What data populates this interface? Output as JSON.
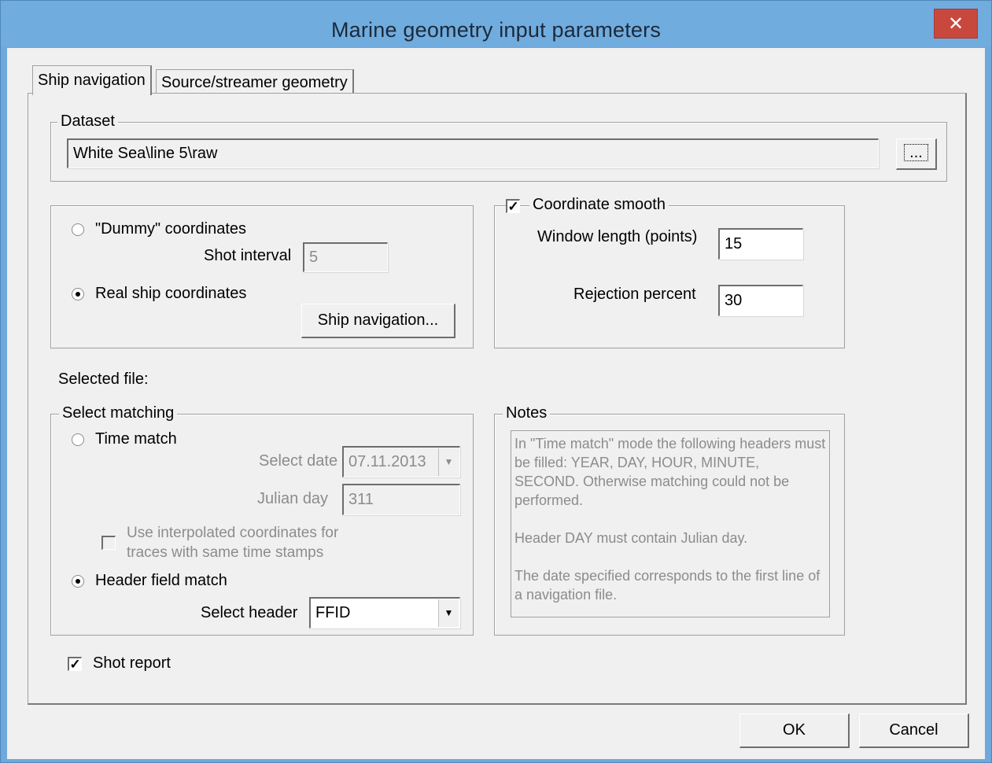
{
  "window": {
    "title": "Marine geometry input parameters",
    "close_glyph": "✕"
  },
  "tabs": [
    {
      "label": "Ship navigation",
      "active": true
    },
    {
      "label": "Source/streamer geometry",
      "active": false
    }
  ],
  "dataset": {
    "group_label": "Dataset",
    "path": "White Sea\\line 5\\raw",
    "browse_label": "..."
  },
  "coord_mode": {
    "dummy_label": "\"Dummy\" coordinates",
    "shot_interval_label": "Shot interval",
    "shot_interval_value": "5",
    "real_label": "Real  ship coordinates",
    "ship_nav_button": "Ship navigation...",
    "selected": "real"
  },
  "smooth": {
    "checkbox_label": "Coordinate smooth",
    "checked": true,
    "window_length_label": "Window length (points)",
    "window_length_value": "15",
    "rejection_label": "Rejection percent",
    "rejection_value": "30"
  },
  "selected_file_label": "Selected file:",
  "matching": {
    "group_label": "Select matching",
    "time_match_label": "Time match",
    "select_date_label": "Select date",
    "select_date_value": "07.11.2013",
    "julian_day_label": "Julian day",
    "julian_day_value": "311",
    "interp_label_line1": "Use interpolated coordinates for",
    "interp_label_line2": "traces with same time stamps",
    "header_match_label": "Header field match",
    "select_header_label": "Select header",
    "select_header_value": "FFID",
    "selected": "header"
  },
  "notes": {
    "group_label": "Notes",
    "p1": "In \"Time match\" mode the following headers must be filled: YEAR, DAY, HOUR, MINUTE, SECOND. Otherwise matching could not be performed.",
    "p2": "Header DAY must contain Julian day.",
    "p3": "The date specified corresponds to the first line of a navigation file."
  },
  "shot_report": {
    "label": "Shot report",
    "checked": true
  },
  "footer": {
    "ok_label": "OK",
    "cancel_label": "Cancel"
  }
}
